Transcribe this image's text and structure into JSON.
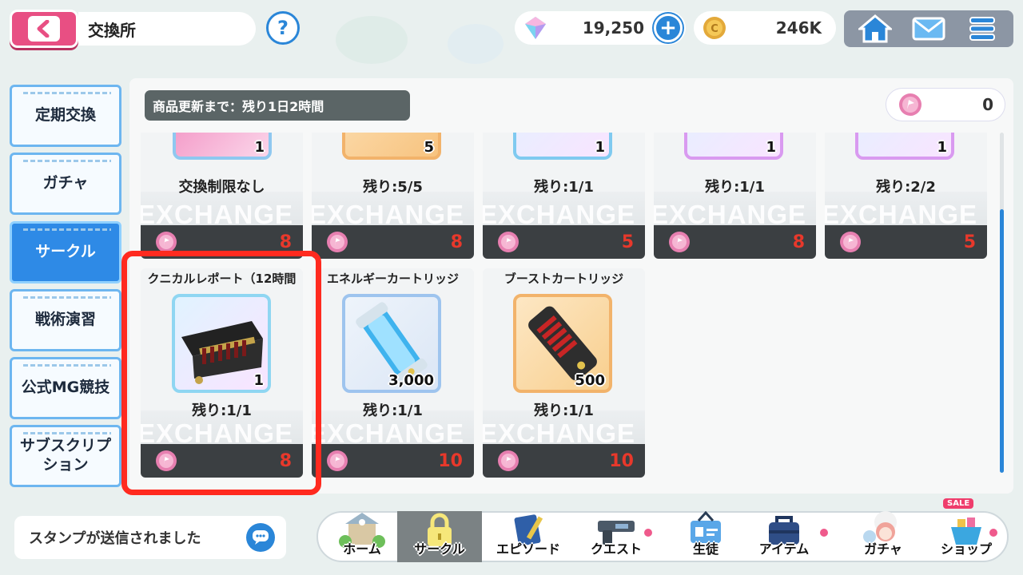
{
  "header": {
    "title": "交換所",
    "gems": "19,250",
    "coins": "246K"
  },
  "side_tabs": [
    {
      "label": "定期交換",
      "active": false
    },
    {
      "label": "ガチャ",
      "active": false
    },
    {
      "label": "サークル",
      "active": true
    },
    {
      "label": "戦術演習",
      "active": false
    },
    {
      "label": "公式MG競技",
      "active": false
    },
    {
      "label": "サブスクリプ\nション",
      "active": false
    }
  ],
  "shop": {
    "refresh_timer": "商品更新まで：残り1日2時間",
    "owned_currency": "0",
    "watermark": "EXCHANGE",
    "items": [
      {
        "name": "",
        "qty": "1",
        "stock": "交換制限なし",
        "price": "8"
      },
      {
        "name": "",
        "qty": "5",
        "stock": "残り:5/5",
        "price": "8"
      },
      {
        "name": "",
        "qty": "1",
        "stock": "残り:1/1",
        "price": "5"
      },
      {
        "name": "",
        "qty": "1",
        "stock": "残り:1/1",
        "price": "8"
      },
      {
        "name": "",
        "qty": "1",
        "stock": "残り:2/2",
        "price": "5"
      },
      {
        "name": "クニカルレポート（12時間",
        "qty": "1",
        "stock": "残り:1/1",
        "price": "8"
      },
      {
        "name": "エネルギーカートリッジ",
        "qty": "3,000",
        "stock": "残り:1/1",
        "price": "10"
      },
      {
        "name": "ブーストカートリッジ",
        "qty": "500",
        "stock": "残り:1/1",
        "price": "10"
      }
    ]
  },
  "toast": {
    "text": "スタンプが送信されました"
  },
  "bottom_nav": [
    {
      "label": "ホーム"
    },
    {
      "label": "サークル"
    },
    {
      "label": "エピソード"
    },
    {
      "label": "クエスト"
    },
    {
      "label": "生徒"
    },
    {
      "label": "アイテム"
    },
    {
      "label": "ガチャ"
    },
    {
      "label": "ショップ"
    }
  ],
  "sale_badge": "SALE",
  "colors": {
    "accent": "#2a86d8",
    "back": "#e84f83",
    "price": "#e8382b",
    "highlight": "#ff2a1f"
  }
}
